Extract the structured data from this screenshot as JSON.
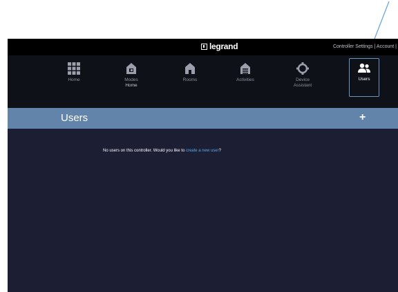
{
  "header": {
    "brand": "legrand",
    "links": [
      "Controller Settings",
      "Account"
    ],
    "separator": "|"
  },
  "nav": {
    "items": [
      {
        "label": "Home",
        "icon": "grid-icon"
      },
      {
        "label": "Modes",
        "sub": "Home",
        "icon": "modes-house-icon"
      },
      {
        "label": "Rooms",
        "icon": "house-icon"
      },
      {
        "label": "Activities",
        "icon": "garage-icon"
      },
      {
        "label": "Device",
        "sub": "Assistant",
        "icon": "gear-icon"
      },
      {
        "label": "Users",
        "icon": "users-icon",
        "active": true
      }
    ]
  },
  "section": {
    "title": "Users",
    "add_icon": "plus-icon"
  },
  "empty_state": {
    "prefix": "No users on this controller. Would you like to",
    "link": "create a new user",
    "suffix": "?"
  },
  "colors": {
    "topbar": "#000000",
    "navbar": "#0e1118",
    "section_header": "#6283aa",
    "content": "#1c1e33",
    "link": "#5fa8e8",
    "annotation_arrow": "#6aa6dd"
  }
}
